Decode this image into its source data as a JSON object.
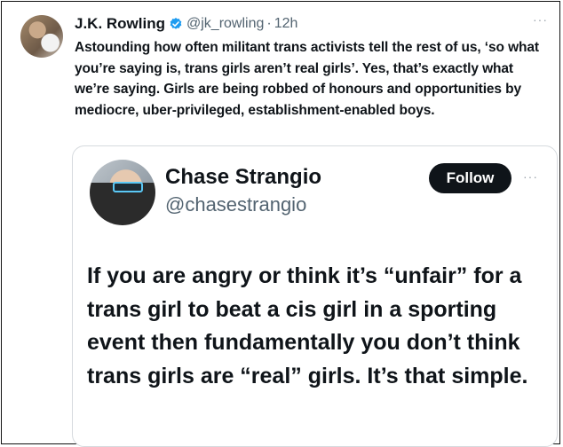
{
  "tweet": {
    "display_name": "J.K. Rowling",
    "handle": "@jk_rowling",
    "separator": "·",
    "time": "12h",
    "more": "···",
    "text": "Astounding how often militant trans activists tell the rest of us, ‘so what you’re saying is, trans girls aren’t real girls’. Yes, that’s exactly what we’re saying. Girls are being robbed of honours and opportunities by mediocre, uber-privileged, establishment-enabled boys."
  },
  "quote": {
    "display_name": "Chase Strangio",
    "handle": "@chasestrangio",
    "follow_label": "Follow",
    "more": "···",
    "text": "If you are angry or think it’s “unfair” for a trans girl to beat a cis girl in a sporting event then fundamentally you don’t think trans girls are “real” girls. It’s that simple."
  },
  "colors": {
    "verified": "#1d9bf0",
    "follow_bg": "#0f1419",
    "muted_text": "#536471"
  },
  "icons": {
    "verified": "verified-badge-icon",
    "more": "more-horizontal-icon"
  }
}
